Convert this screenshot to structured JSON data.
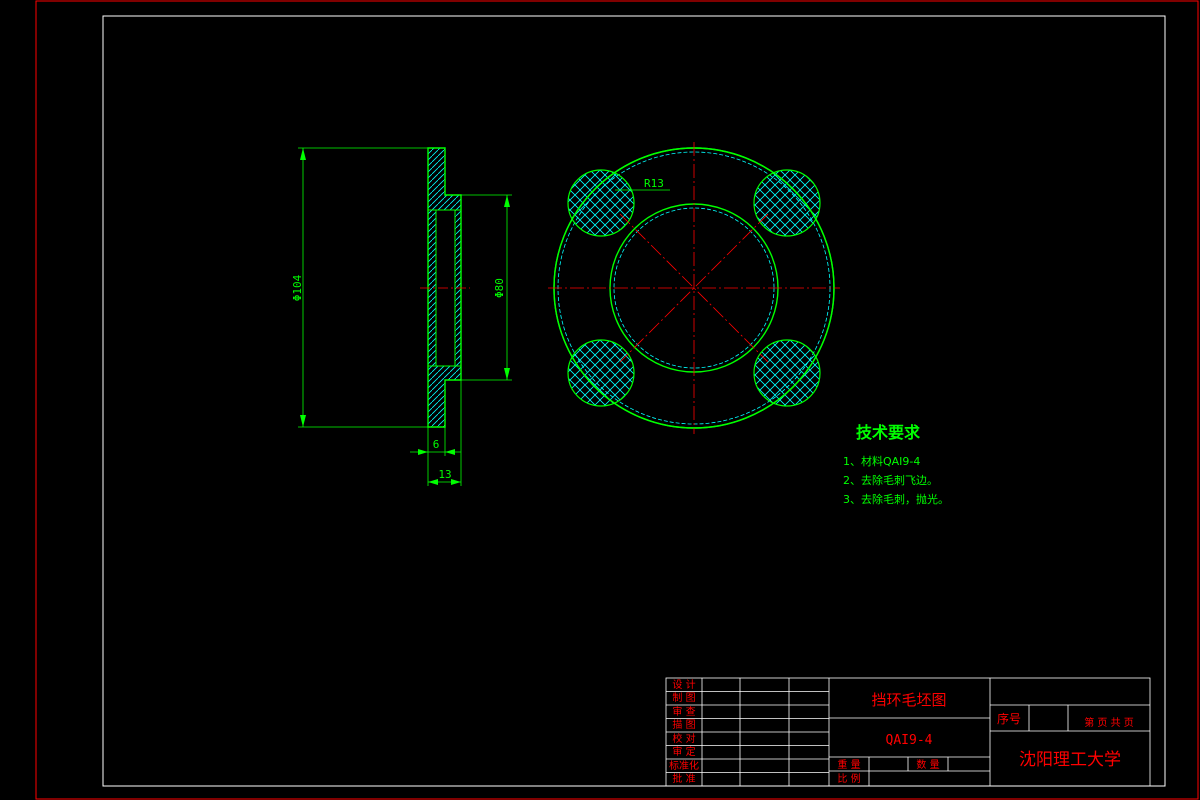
{
  "part": {
    "dim_outer_diameter": "Φ104",
    "dim_bore_diameter": "Φ80",
    "dim_flange_thickness": "6",
    "dim_total_length": "13",
    "dim_radius": "R13"
  },
  "tech_requirements": {
    "title": "技术要求",
    "items": [
      "1、材料QAI9-4",
      "2、去除毛刺飞边。",
      "3、去除毛刺，抛光。"
    ]
  },
  "title_block": {
    "drawing_name": "挡环毛坯图",
    "material": "QAI9-4",
    "school": "沈阳理工大学",
    "serial_label": "序号",
    "sheet_label": "第 页 共 页",
    "weight_label": "重 量",
    "quantity_label": "数 量",
    "scale_label": "比 例",
    "rows": [
      "设 计",
      "制 图",
      "审 查",
      "描 图",
      "校 对",
      "审 定",
      "标准化",
      "批 准"
    ]
  },
  "colors": {
    "frame": "#ff0000",
    "part_outline": "#00ff00",
    "hatch": "#00ffff",
    "centerline": "#ff0000",
    "text": "#00ff00"
  }
}
